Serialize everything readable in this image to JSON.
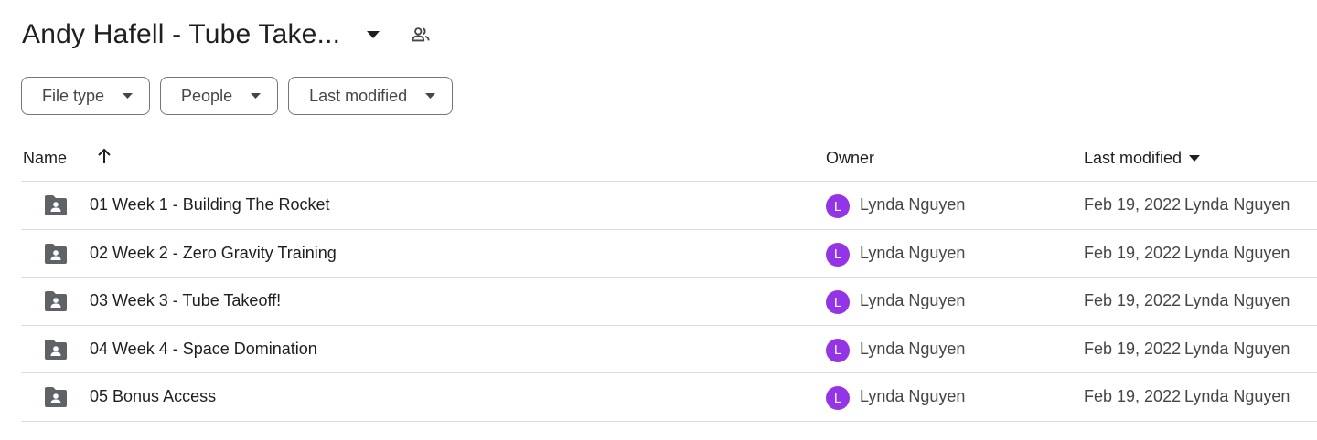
{
  "header": {
    "folder_title": "Andy Hafell - Tube Take...",
    "caret_icon": "arrow-drop-down-icon",
    "shared_icon": "people-icon"
  },
  "filters": [
    {
      "label": "File type"
    },
    {
      "label": "People"
    },
    {
      "label": "Last modified"
    }
  ],
  "table": {
    "columns": {
      "name": "Name",
      "owner": "Owner",
      "last_modified": "Last modified"
    },
    "sort_icon": "arrow-up-icon",
    "rows": [
      {
        "name": "01 Week 1 - Building The Rocket",
        "avatar_letter": "L",
        "owner": "Lynda Nguyen",
        "date": "Feb 19, 2022",
        "modified_by": "Lynda Nguyen"
      },
      {
        "name": "02 Week 2 - Zero Gravity Training",
        "avatar_letter": "L",
        "owner": "Lynda Nguyen",
        "date": "Feb 19, 2022",
        "modified_by": "Lynda Nguyen"
      },
      {
        "name": "03 Week 3 - Tube Takeoff!",
        "avatar_letter": "L",
        "owner": "Lynda Nguyen",
        "date": "Feb 19, 2022",
        "modified_by": "Lynda Nguyen"
      },
      {
        "name": "04 Week 4 - Space Domination",
        "avatar_letter": "L",
        "owner": "Lynda Nguyen",
        "date": "Feb 19, 2022",
        "modified_by": "Lynda Nguyen"
      },
      {
        "name": "05 Bonus Access",
        "avatar_letter": "L",
        "owner": "Lynda Nguyen",
        "date": "Feb 19, 2022",
        "modified_by": "Lynda Nguyen"
      }
    ]
  },
  "colors": {
    "avatar": "#9334e6",
    "folder_icon": "#5f6368",
    "divider": "#dadce0"
  }
}
